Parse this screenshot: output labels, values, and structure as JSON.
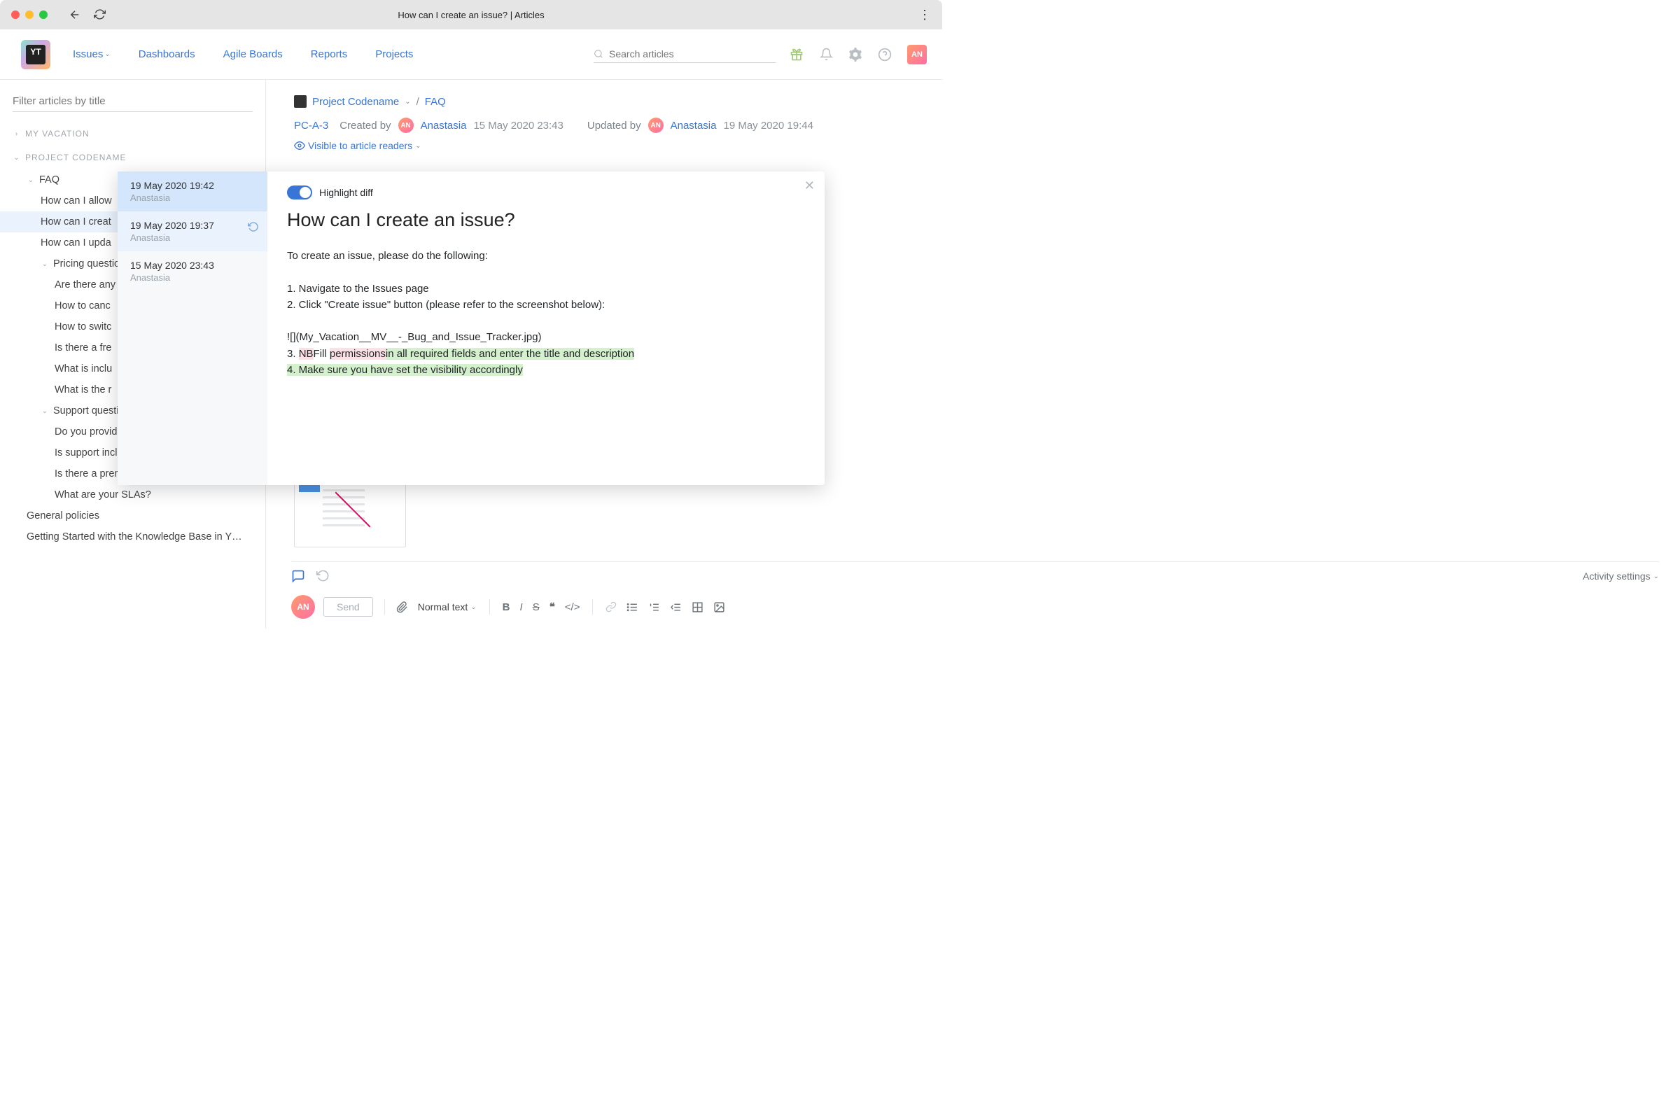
{
  "window": {
    "title": "How can I create an issue? | Articles"
  },
  "nav": {
    "items": [
      "Issues",
      "Dashboards",
      "Agile Boards",
      "Reports",
      "Projects"
    ],
    "search_placeholder": "Search articles",
    "avatar": "AN"
  },
  "sidebar": {
    "filter_placeholder": "Filter articles by title",
    "groups": [
      {
        "title": "My Vacation",
        "expanded": false
      },
      {
        "title": "Project Codename",
        "expanded": true
      }
    ],
    "faq_label": "FAQ",
    "faq_items": [
      "How can I allow",
      "How can I creat",
      "How can I upda"
    ],
    "pricing_label": "Pricing question",
    "pricing_items": [
      "Are there any",
      "How to canc",
      "How to switc",
      "Is there a fre",
      "What is inclu",
      "What is the r"
    ],
    "support_label": "Support questio",
    "support_items": [
      "Do you provide any support?",
      "Is support included in my subscription?",
      "Is there a premium support service?",
      "What are your SLAs?"
    ],
    "general_label": "General policies",
    "getting_started_label": "Getting Started with the Knowledge Base in Y…"
  },
  "breadcrumb": {
    "project": "Project Codename",
    "page": "FAQ"
  },
  "meta": {
    "id": "PC-A-3",
    "created_label": "Created by",
    "created_name": "Anastasia",
    "created_date": "15 May 2020 23:43",
    "updated_label": "Updated by",
    "updated_name": "Anastasia",
    "updated_date": "19 May 2020 19:44",
    "visibility": "Visible to article readers"
  },
  "history": [
    {
      "date": "19 May 2020 19:42",
      "author": "Anastasia"
    },
    {
      "date": "19 May 2020 19:37",
      "author": "Anastasia"
    },
    {
      "date": "15 May 2020 23:43",
      "author": "Anastasia"
    }
  ],
  "diff": {
    "toggle_label": "Highlight diff",
    "title": "How can I create an issue?",
    "intro": "To create an issue, please do the following:",
    "step1": "1. Navigate to the Issues page",
    "step2": "2. Click \"Create issue\" button (please refer to the screenshot below):",
    "img_ref": "  ![](My_Vacation__MV__-_Bug_and_Issue_Tracker.jpg)",
    "s3_pre": "3. ",
    "s3_del1": "NB",
    "s3_mid": "Fill ",
    "s3_del2": "permissions",
    "s3_add": "in all required fields and enter the title and description",
    "s4": "4. Make sure you have set the visibility accordingly"
  },
  "footer": {
    "activity_label": "Activity settings",
    "send_label": "Send",
    "normal_label": "Normal text",
    "avatar": "AN"
  }
}
